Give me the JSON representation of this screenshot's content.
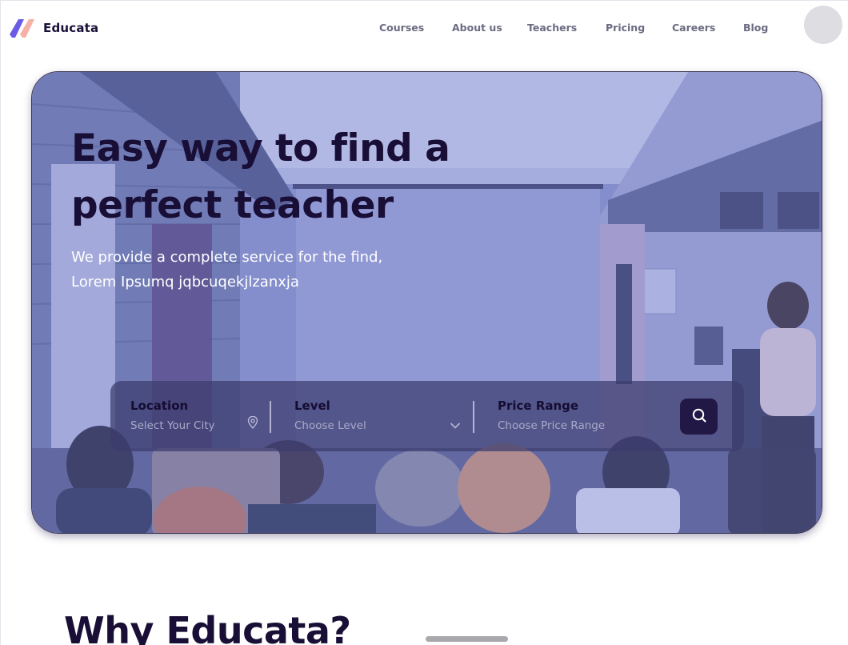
{
  "brand": {
    "name": "Educata",
    "colors": {
      "primary": "#6b5ce7",
      "accent": "#f5a9a0",
      "dark": "#180e36"
    }
  },
  "nav": {
    "links": [
      "Courses",
      "About us",
      "Teachers",
      "Pricing",
      "Careers",
      "Blog"
    ]
  },
  "hero": {
    "title_line1": "Easy way to find a",
    "title_line2": "perfect teacher",
    "subtitle_line1": "We provide a complete service for the find,",
    "subtitle_line2": "Lorem Ipsumq jqbcuqekjlzanxja"
  },
  "search": {
    "location": {
      "label": "Location",
      "placeholder": "Select Your City",
      "icon": "map-pin-icon"
    },
    "level": {
      "label": "Level",
      "placeholder": "Choose Level",
      "icon": "chevron-down-icon"
    },
    "price": {
      "label": "Price Range",
      "placeholder": "Choose Price Range"
    },
    "button_icon": "search-icon"
  },
  "section": {
    "title": "Why Educata?"
  }
}
